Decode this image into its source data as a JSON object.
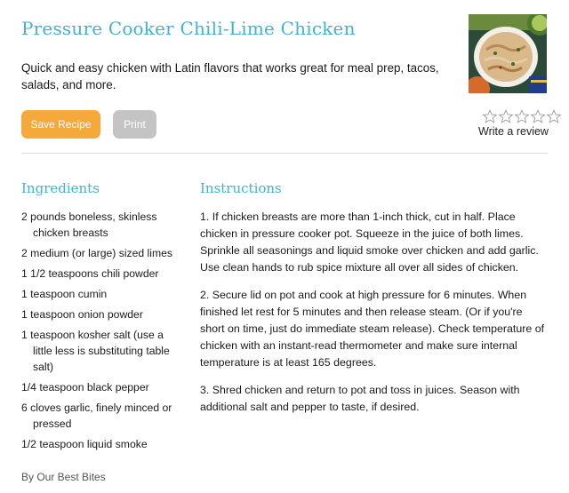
{
  "recipe": {
    "title": "Pressure Cooker Chili-Lime Chicken",
    "description": "Quick and easy chicken with Latin flavors that works great for meal prep, tacos, salads, and more."
  },
  "actions": {
    "save_label": "Save Recipe",
    "print_label": "Print",
    "save_color": "#f6a93b",
    "print_color": "#c4c4c4"
  },
  "rating": {
    "stars_filled": 0,
    "stars_total": 5,
    "review_label": "Write a review"
  },
  "ingredients": {
    "heading": "Ingredients",
    "items": [
      "2 pounds boneless, skinless chicken breasts",
      "2 medium (or large) sized limes",
      "1 1/2 teaspoons chili powder",
      "1 teaspoon cumin",
      "1 teaspoon onion powder",
      "1 teaspoon kosher salt (use a little less is substituting table salt)",
      "1/4 teaspoon black pepper",
      "6 cloves garlic, finely minced or pressed",
      "1/2 teaspoon liquid smoke"
    ]
  },
  "instructions": {
    "heading": "Instructions",
    "steps": [
      "1. If chicken breasts are more than 1-inch thick, cut in half. Place chicken in pressure cooker pot. Squeeze in the juice of both limes. Sprinkle all seasonings and liquid smoke over chicken and add garlic. Use clean hands to rub spice mixture all over all sides of chicken.",
      "2. Secure lid on pot and cook at high pressure for 6 minutes. When finished let rest for 5 minutes and then release steam. (Or if you're short on time, just do immediate steam release). Check temperature of chicken with an instant-read thermometer and make sure internal temperature is at least 165 degrees.",
      "3. Shred chicken and return to pot and toss in juices. Season with additional salt and pepper to taste, if desired."
    ]
  },
  "byline": "By Our Best Bites",
  "colors": {
    "accent": "#3fb3cf",
    "text": "#1a1a1a"
  }
}
